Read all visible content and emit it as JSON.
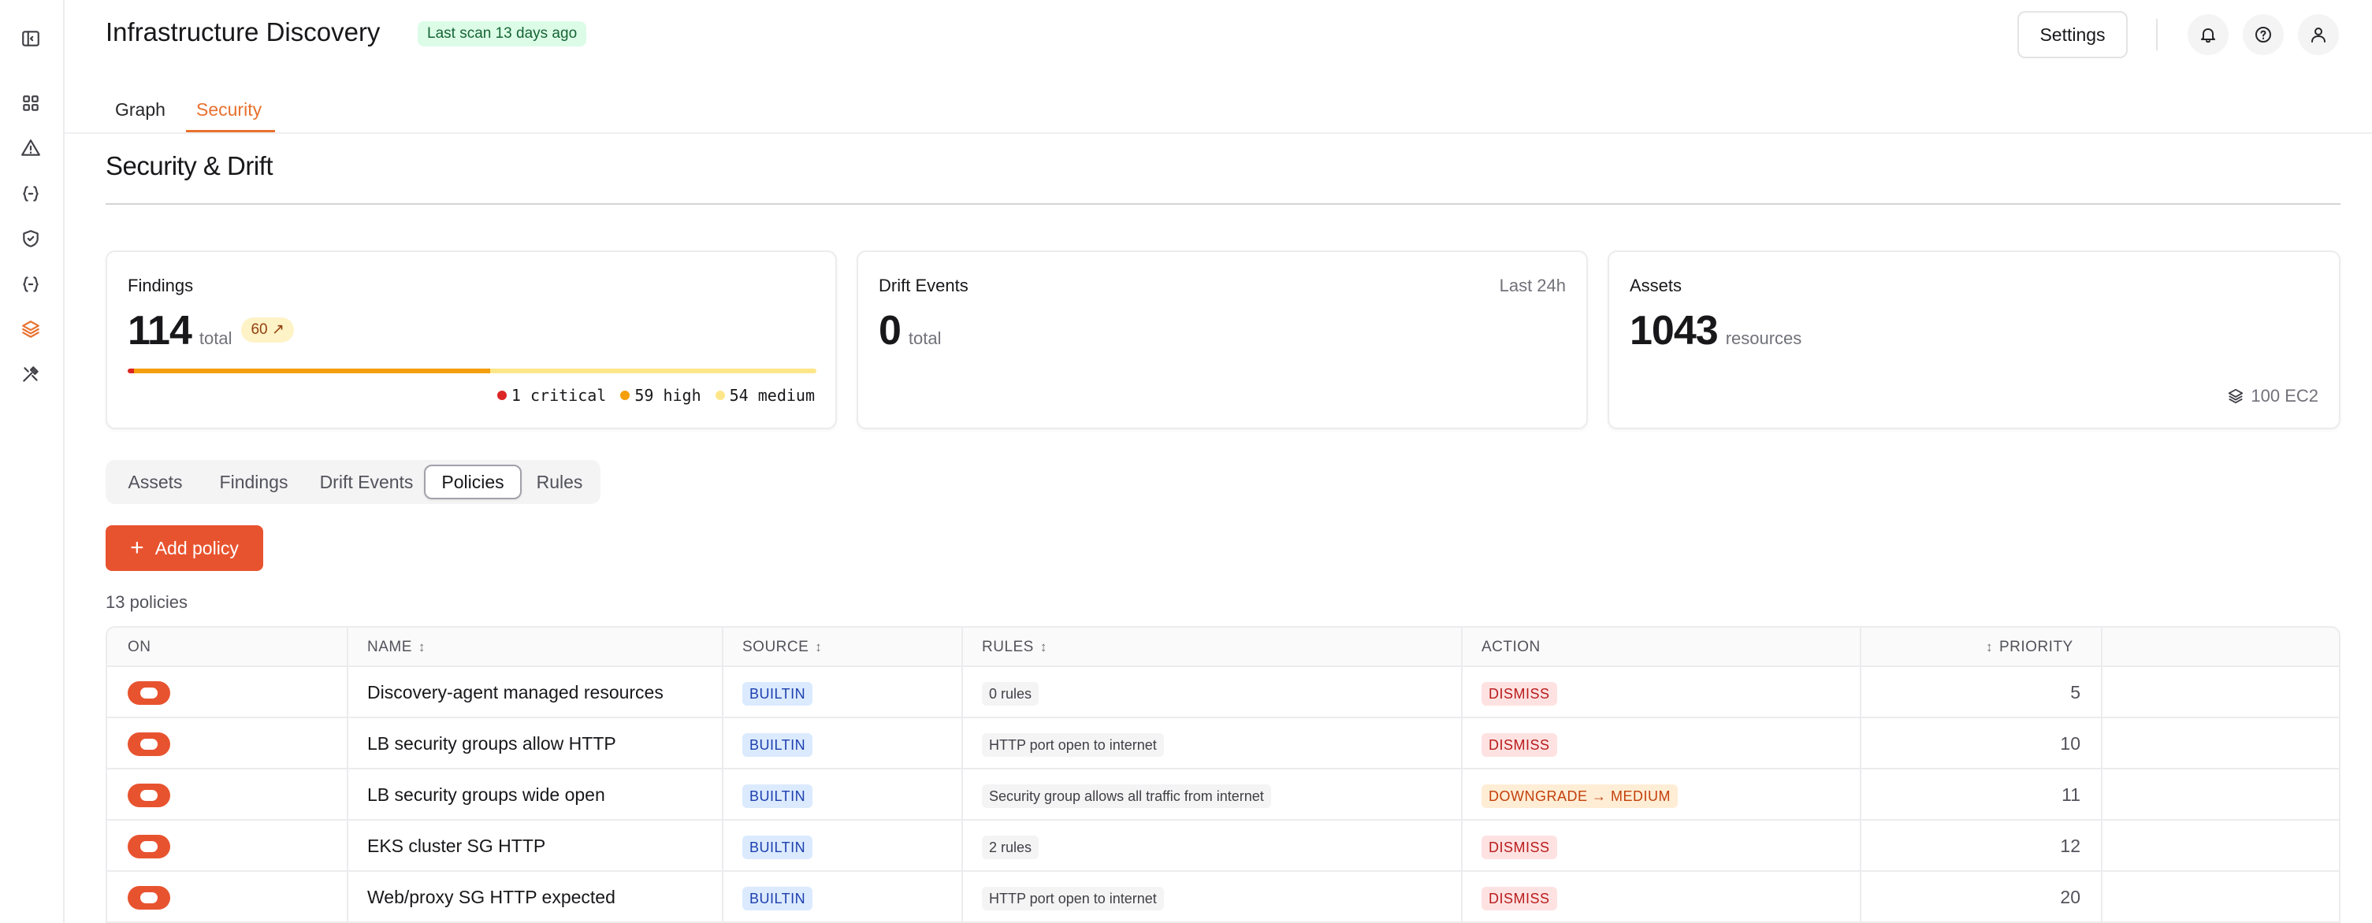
{
  "sidebar": {
    "icons": [
      "sidebar-toggle-icon",
      "grid-icon",
      "alert-triangle-icon",
      "code-braces-icon",
      "shield-check-icon",
      "code-braces-icon",
      "layers-icon",
      "tools-icon"
    ],
    "active_index": 6
  },
  "header": {
    "title": "Infrastructure Discovery",
    "scan_badge": "Last scan 13 days ago",
    "settings_label": "Settings"
  },
  "top_tabs": [
    {
      "label": "Graph",
      "active": false
    },
    {
      "label": "Security",
      "active": true
    }
  ],
  "section": {
    "title": "Security & Drift"
  },
  "cards": {
    "findings": {
      "label": "Findings",
      "value": "114",
      "unit": "total",
      "trend": "60 ↗",
      "severity": [
        {
          "label": "1 critical",
          "count": 1,
          "color": "#dc2626"
        },
        {
          "label": "59 high",
          "count": 59,
          "color": "#f59e0b"
        },
        {
          "label": "54 medium",
          "count": 54,
          "color": "#fde68a"
        }
      ]
    },
    "drift": {
      "label": "Drift Events",
      "period": "Last 24h",
      "value": "0",
      "unit": "total"
    },
    "assets": {
      "label": "Assets",
      "value": "1043",
      "unit": "resources",
      "footer": "100 EC2"
    }
  },
  "sub_tabs": [
    {
      "label": "Assets",
      "active": false
    },
    {
      "label": "Findings",
      "active": false
    },
    {
      "label": "Drift Events",
      "active": false
    },
    {
      "label": "Policies",
      "active": true
    },
    {
      "label": "Rules",
      "active": false
    }
  ],
  "policies": {
    "add_label": "Add policy",
    "count_text": "13 policies",
    "columns": {
      "on": "ON",
      "name": "NAME",
      "source": "SOURCE",
      "rules": "RULES",
      "action": "ACTION",
      "priority": "PRIORITY"
    },
    "rows": [
      {
        "enabled": true,
        "name": "Discovery-agent managed resources",
        "source": "BUILTIN",
        "rules": "0 rules",
        "action": "DISMISS",
        "action_type": "dismiss",
        "priority": "5"
      },
      {
        "enabled": true,
        "name": "LB security groups allow HTTP",
        "source": "BUILTIN",
        "rules": "HTTP port open to internet",
        "action": "DISMISS",
        "action_type": "dismiss",
        "priority": "10"
      },
      {
        "enabled": true,
        "name": "LB security groups wide open",
        "source": "BUILTIN",
        "rules": "Security group allows all traffic from internet",
        "action": "DOWNGRADE → MEDIUM",
        "action_type": "downgrade",
        "priority": "11"
      },
      {
        "enabled": true,
        "name": "EKS cluster SG HTTP",
        "source": "BUILTIN",
        "rules": "2 rules",
        "action": "DISMISS",
        "action_type": "dismiss",
        "priority": "12"
      },
      {
        "enabled": true,
        "name": "Web/proxy SG HTTP expected",
        "source": "BUILTIN",
        "rules": "HTTP port open to internet",
        "action": "DISMISS",
        "action_type": "dismiss",
        "priority": "20"
      }
    ]
  },
  "colors": {
    "accent": "#e8712f",
    "primary_button": "#e8532f",
    "toggle_on": "#e8532f"
  }
}
